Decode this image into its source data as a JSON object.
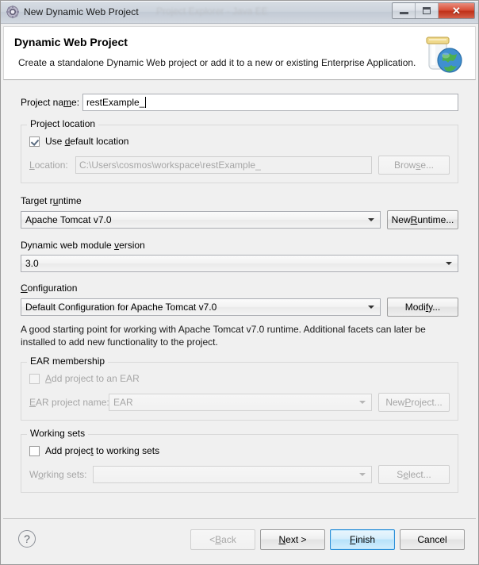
{
  "window": {
    "title": "New Dynamic Web Project",
    "icon": "wizard-gear-icon",
    "ghost_text": "Project Explorer  -  Java EE",
    "controls": {
      "minimize": "minimize-icon",
      "maximize": "maximize-icon",
      "close": "close-icon"
    }
  },
  "header": {
    "title": "Dynamic Web Project",
    "description": "Create a standalone Dynamic Web project or add it to a new or existing Enterprise Application.",
    "art": "jar-globe-icon"
  },
  "project_name": {
    "label": "Project name:",
    "mnemonic": "m",
    "value": "restExample_",
    "has_caret": true
  },
  "project_location": {
    "group_title": "Project location",
    "use_default": {
      "label": "Use default location",
      "mnemonic": "d",
      "checked": true,
      "enabled": true
    },
    "location": {
      "label": "Location:",
      "mnemonic": "L",
      "value": "C:\\Users\\cosmos\\workspace\\restExample_",
      "enabled": false
    },
    "browse_button": {
      "label": "Browse...",
      "mnemonic": "s",
      "enabled": false
    }
  },
  "target_runtime": {
    "label": "Target runtime",
    "mnemonic": "u",
    "value": "Apache Tomcat v7.0",
    "new_button": {
      "label": "New Runtime...",
      "mnemonic": "R",
      "enabled": true
    }
  },
  "module_version": {
    "label": "Dynamic web module version",
    "mnemonic": "v",
    "value": "3.0"
  },
  "configuration": {
    "label": "Configuration",
    "mnemonic": "C",
    "value": "Default Configuration for Apache Tomcat v7.0",
    "modify_button": {
      "label": "Modify...",
      "mnemonic": "f",
      "enabled": true
    },
    "description": "A good starting point for working with Apache Tomcat v7.0 runtime. Additional facets can later be installed to add new functionality to the project."
  },
  "ear_membership": {
    "group_title": "EAR membership",
    "add_checkbox": {
      "label": "Add project to an EAR",
      "mnemonic": "A",
      "checked": false,
      "enabled": false
    },
    "ear_project_name": {
      "label": "EAR project name:",
      "mnemonic": "E",
      "value": "EAR",
      "enabled": false
    },
    "new_project_button": {
      "label": "New Project...",
      "mnemonic": "P",
      "enabled": false
    }
  },
  "working_sets": {
    "group_title": "Working sets",
    "add_checkbox": {
      "label": "Add project to working sets",
      "mnemonic": "t",
      "checked": false,
      "enabled": true
    },
    "working_sets_field": {
      "label": "Working sets:",
      "mnemonic": "o",
      "value": "",
      "enabled": false
    },
    "select_button": {
      "label": "Select...",
      "mnemonic": "e",
      "enabled": false
    }
  },
  "buttons": {
    "help": "?",
    "back": {
      "label": "< Back",
      "mnemonic": "B",
      "enabled": false
    },
    "next": {
      "label": "Next >",
      "mnemonic": "N",
      "enabled": true
    },
    "finish": {
      "label": "Finish",
      "mnemonic": "F",
      "enabled": true,
      "is_default": true
    },
    "cancel": {
      "label": "Cancel",
      "enabled": true
    }
  },
  "colors": {
    "dialog_bg": "#f0f0f0",
    "default_button_border": "#2a8fd8",
    "close_button": "#bf3018",
    "disabled_text": "#a6a6a6"
  }
}
